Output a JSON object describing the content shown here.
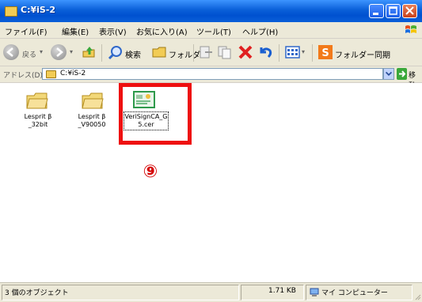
{
  "window": {
    "title": "C:¥iS-2"
  },
  "menu": {
    "items": [
      "ファイル(F)",
      "編集(E)",
      "表示(V)",
      "お気に入り(A)",
      "ツール(T)",
      "ヘルプ(H)"
    ]
  },
  "toolbar": {
    "back_label": "戻る",
    "search_label": "検索",
    "folders_label": "フォルダ",
    "sync_label": "フォルダー同期"
  },
  "address": {
    "label": "アドレス(D)",
    "value": "C:¥iS-2",
    "go_label": "移動"
  },
  "files": [
    {
      "name_line1": "Lesprit β",
      "name_line2": "_32bit",
      "type": "folder"
    },
    {
      "name_line1": "Lesprit β",
      "name_line2": "_V90050",
      "type": "folder"
    },
    {
      "name_line1": "VeriSignCA_G",
      "name_line2": "5.cer",
      "type": "certificate",
      "selected": true
    }
  ],
  "annotation": {
    "step_marker": "⑨",
    "highlight_color": "#ee1010"
  },
  "status": {
    "objects": "3 個のオブジェクト",
    "size": "1.71 KB",
    "location": "マイ コンピューター"
  },
  "colors": {
    "titlebar": "#0a5fd8",
    "chrome": "#ece9d8",
    "folder": "#f2cc55",
    "cert_border": "#2f9a4c"
  },
  "icons": [
    "folder-icon",
    "back-icon",
    "forward-icon",
    "up-icon",
    "search-icon",
    "folders-icon",
    "move-icon",
    "copy-icon",
    "delete-icon",
    "undo-icon",
    "views-icon",
    "sync-icon",
    "go-icon",
    "windows-logo-icon",
    "my-computer-icon",
    "certificate-icon"
  ]
}
